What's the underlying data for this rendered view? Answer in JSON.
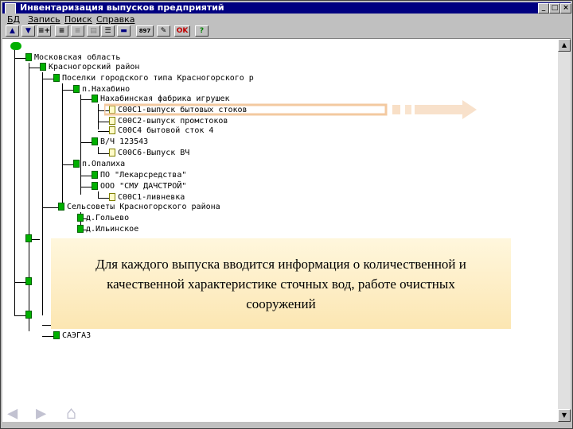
{
  "window": {
    "title": "Инвентаризация выпусков предприятий"
  },
  "titlebar_buttons": [
    "_",
    "□",
    "×"
  ],
  "menu": [
    "БД",
    "Запись",
    "Поиск",
    "Справка"
  ],
  "toolbar": {
    "filter_label": "897",
    "ok_label": "OK",
    "help_label": "?"
  },
  "tree": [
    {
      "label": "Московская область",
      "icon": "folder"
    },
    {
      "label": "Красногорский район",
      "icon": "folder"
    },
    {
      "label": "Поселки городского типа Красногорского р",
      "icon": "folder"
    },
    {
      "label": "п.Нахабино",
      "icon": "folder"
    },
    {
      "label": "Нахабинская фабрика игрушек",
      "icon": "folder"
    },
    {
      "label": "С00С1-выпуск бытовых стоков",
      "icon": "document"
    },
    {
      "label": "С00С2-выпуск промстоков",
      "icon": "document"
    },
    {
      "label": "С00С4 бытовой сток 4",
      "icon": "document"
    },
    {
      "label": "В/Ч 123543",
      "icon": "folder"
    },
    {
      "label": "С00С6-Выпуск ВЧ",
      "icon": "document"
    },
    {
      "label": "п.Опалиха",
      "icon": "folder"
    },
    {
      "label": "ПО \"Лекарсредства\"",
      "icon": "folder"
    },
    {
      "label": "ООО \"СМУ ДАЧСТРОЙ\"",
      "icon": "folder"
    },
    {
      "label": "С00С1-ливневка",
      "icon": "document"
    },
    {
      "label": "Сельсоветы Красногорского района",
      "icon": "folder"
    },
    {
      "label": "д.Гольево",
      "icon": "folder"
    },
    {
      "label": "д.Ильинское",
      "icon": "folder"
    },
    {
      "label": "САЭГАЗ",
      "icon": "folder"
    }
  ],
  "callout": {
    "line1": "Для каждого выпуска вводится информация о количественной и",
    "line2": "качественной характеристике сточных вод, работе очистных",
    "line3": "сооружений"
  },
  "arrow_color": "#f3c9a0",
  "accent": "#000080"
}
